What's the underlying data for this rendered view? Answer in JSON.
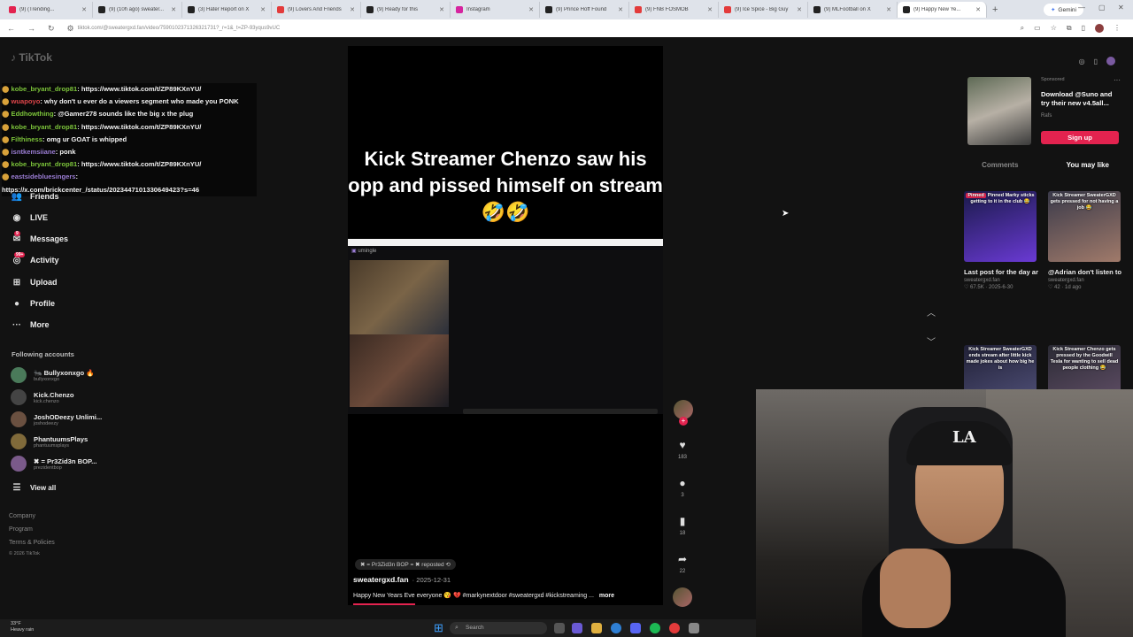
{
  "browser": {
    "tabs": [
      {
        "label": "(9) (Trending...",
        "color": "#e3234f"
      },
      {
        "label": "(9) (10h ago) sweater...",
        "color": "#222222"
      },
      {
        "label": "(3) Hater Report on X",
        "color": "#222222"
      },
      {
        "label": "(9) Lovers And Friends",
        "color": "#e33b3b"
      },
      {
        "label": "(9) Ready for this",
        "color": "#222222"
      },
      {
        "label": "Instagram",
        "color": "#d6249f"
      },
      {
        "label": "(9) Prince Hoff Found",
        "color": "#222222"
      },
      {
        "label": "(9) FNB FOSMOB",
        "color": "#e33b3b"
      },
      {
        "label": "(9) Ice Spice - Big Guy",
        "color": "#e33b3b"
      },
      {
        "label": "(9) MLFootball on X",
        "color": "#222222"
      },
      {
        "label": "(9) Happy New Ye...",
        "color": "#222222",
        "active": true
      }
    ],
    "gemini_label": "Gemini",
    "url": "tiktok.com/@sweatergxd.fan/video/7590102371326321731?_r=1&_t=ZP-93yqus9vUC"
  },
  "sidebar": {
    "logo": "TikTok",
    "chat": [
      {
        "user": "kobe_bryant_drop81",
        "user_color": "green",
        "msg": ": https://www.tiktok.com/t/ZP89KXnYU/"
      },
      {
        "user": "wuapoyo",
        "user_color": "red",
        "msg": ": why don't u ever do a viewers segment who made you PONK"
      },
      {
        "user": "Eddhowthing",
        "user_color": "green",
        "msg": ": @Gamer278 sounds like the big x the plug"
      },
      {
        "user": "kobe_bryant_drop81",
        "user_color": "green",
        "msg": ": https://www.tiktok.com/t/ZP89KXnYU/"
      },
      {
        "user": "Filthiness",
        "user_color": "green",
        "msg": ": omg ur GOAT is whipped"
      },
      {
        "user": "isntkemsiiane",
        "user_color": "purple",
        "msg": ": ponk"
      },
      {
        "user": "kobe_bryant_drop81",
        "user_color": "green",
        "msg": ": https://www.tiktok.com/t/ZP89KXnYU/"
      },
      {
        "user": "eastsidebluesingers",
        "user_color": "purple",
        "msg": ":"
      },
      {
        "user": "",
        "user_color": "green",
        "msg": "https://x.com/brickcenter_/status/2023447101330649423?s=46"
      }
    ],
    "nav": [
      {
        "label": "Friends",
        "icon": "friends-icon",
        "glyph": "👥"
      },
      {
        "label": "LIVE",
        "icon": "live-icon",
        "glyph": "◉"
      },
      {
        "label": "Messages",
        "icon": "messages-icon",
        "glyph": "✉",
        "badge": "9"
      },
      {
        "label": "Activity",
        "icon": "activity-icon",
        "glyph": "◎",
        "badge": "99+"
      },
      {
        "label": "Upload",
        "icon": "upload-icon",
        "glyph": "⊞"
      },
      {
        "label": "Profile",
        "icon": "profile-icon",
        "glyph": "●"
      },
      {
        "label": "More",
        "icon": "more-icon",
        "glyph": "···"
      }
    ],
    "following_header": "Following accounts",
    "following": [
      {
        "name": "🐜 Bullyxonxgo 🔥",
        "handle": "bullyxonxgo",
        "color": "#4a7a5a"
      },
      {
        "name": "Kick.Chenzo",
        "handle": "kick.chenzo",
        "color": "#444444"
      },
      {
        "name": "JoshODeezy Unlimi...",
        "handle": "joshodeezy",
        "color": "#6a5040"
      },
      {
        "name": "PhantuumsPlays",
        "handle": "phantuumsplays",
        "color": "#806a3a"
      },
      {
        "name": "✖ = Pr3Zid3n BOP...",
        "handle": "prezidentbop",
        "color": "#7a5a8a"
      }
    ],
    "view_all": "View all",
    "footer": [
      "Company",
      "Program",
      "Terms & Policies",
      "© 2026 TikTok"
    ]
  },
  "video": {
    "caption": "Kick Streamer Chenzo saw his opp and pissed himself on stream 🤣🤣",
    "embed_channel": "umingle",
    "reposted": "✖ = Pr3Zid3n BOP = ✖ reposted",
    "author": "sweatergxd.fan",
    "date": "· 2025-12-31",
    "description": "Happy New Years Eve everyone 😘 💔 #markynextdoor #sweatergxd #kickstreaming ...",
    "more": "more"
  },
  "actions": {
    "likes": "183",
    "comments": "3",
    "saves": "18",
    "shares": "22"
  },
  "right_panel": {
    "sponsored": "Sponsored",
    "ad_title": "Download @Suno and try their new v4.5all...",
    "ad_sub": "Rafs",
    "signup": "Sign up",
    "tab_comments": "Comments",
    "tab_you_may_like": "You may like",
    "grid": [
      {
        "overlay": "Pinned Marky sticks getting to it in the club 😂",
        "pinned": true,
        "title": "Last post for the day and @Mark...",
        "author": "sweatergxd.fan",
        "stats": "♡ 67.5K · 2025-6-30",
        "colors": [
          "#1a1a4a",
          "#6a3ad4"
        ]
      },
      {
        "overlay": "Kick Streamer SweaterGXD gets pressed for not having a job 😂",
        "pinned": false,
        "title": "@Adrian don't listen to the hate...",
        "author": "sweatergxd.fan",
        "stats": "♡ 42 · 1d ago",
        "colors": [
          "#3a3a4a",
          "#a07a6a"
        ]
      },
      {
        "overlay": "Kick Streamer SweaterGXD ends stream after little kick made jokes about how big he is",
        "pinned": false,
        "title": "",
        "author": "",
        "stats": "",
        "colors": [
          "#202036",
          "#4a4a70"
        ]
      },
      {
        "overlay": "Kick Streamer Chenzo gets pressed by the Goodwill Tesla for wanting to sell dead people clothing 😂",
        "pinned": false,
        "title": "",
        "author": "",
        "stats": "",
        "colors": [
          "#2a2a34",
          "#5a4a60"
        ]
      }
    ]
  },
  "taskbar": {
    "weather_temp": "33°F",
    "weather_desc": "Heavy rain",
    "search_placeholder": "Search"
  }
}
